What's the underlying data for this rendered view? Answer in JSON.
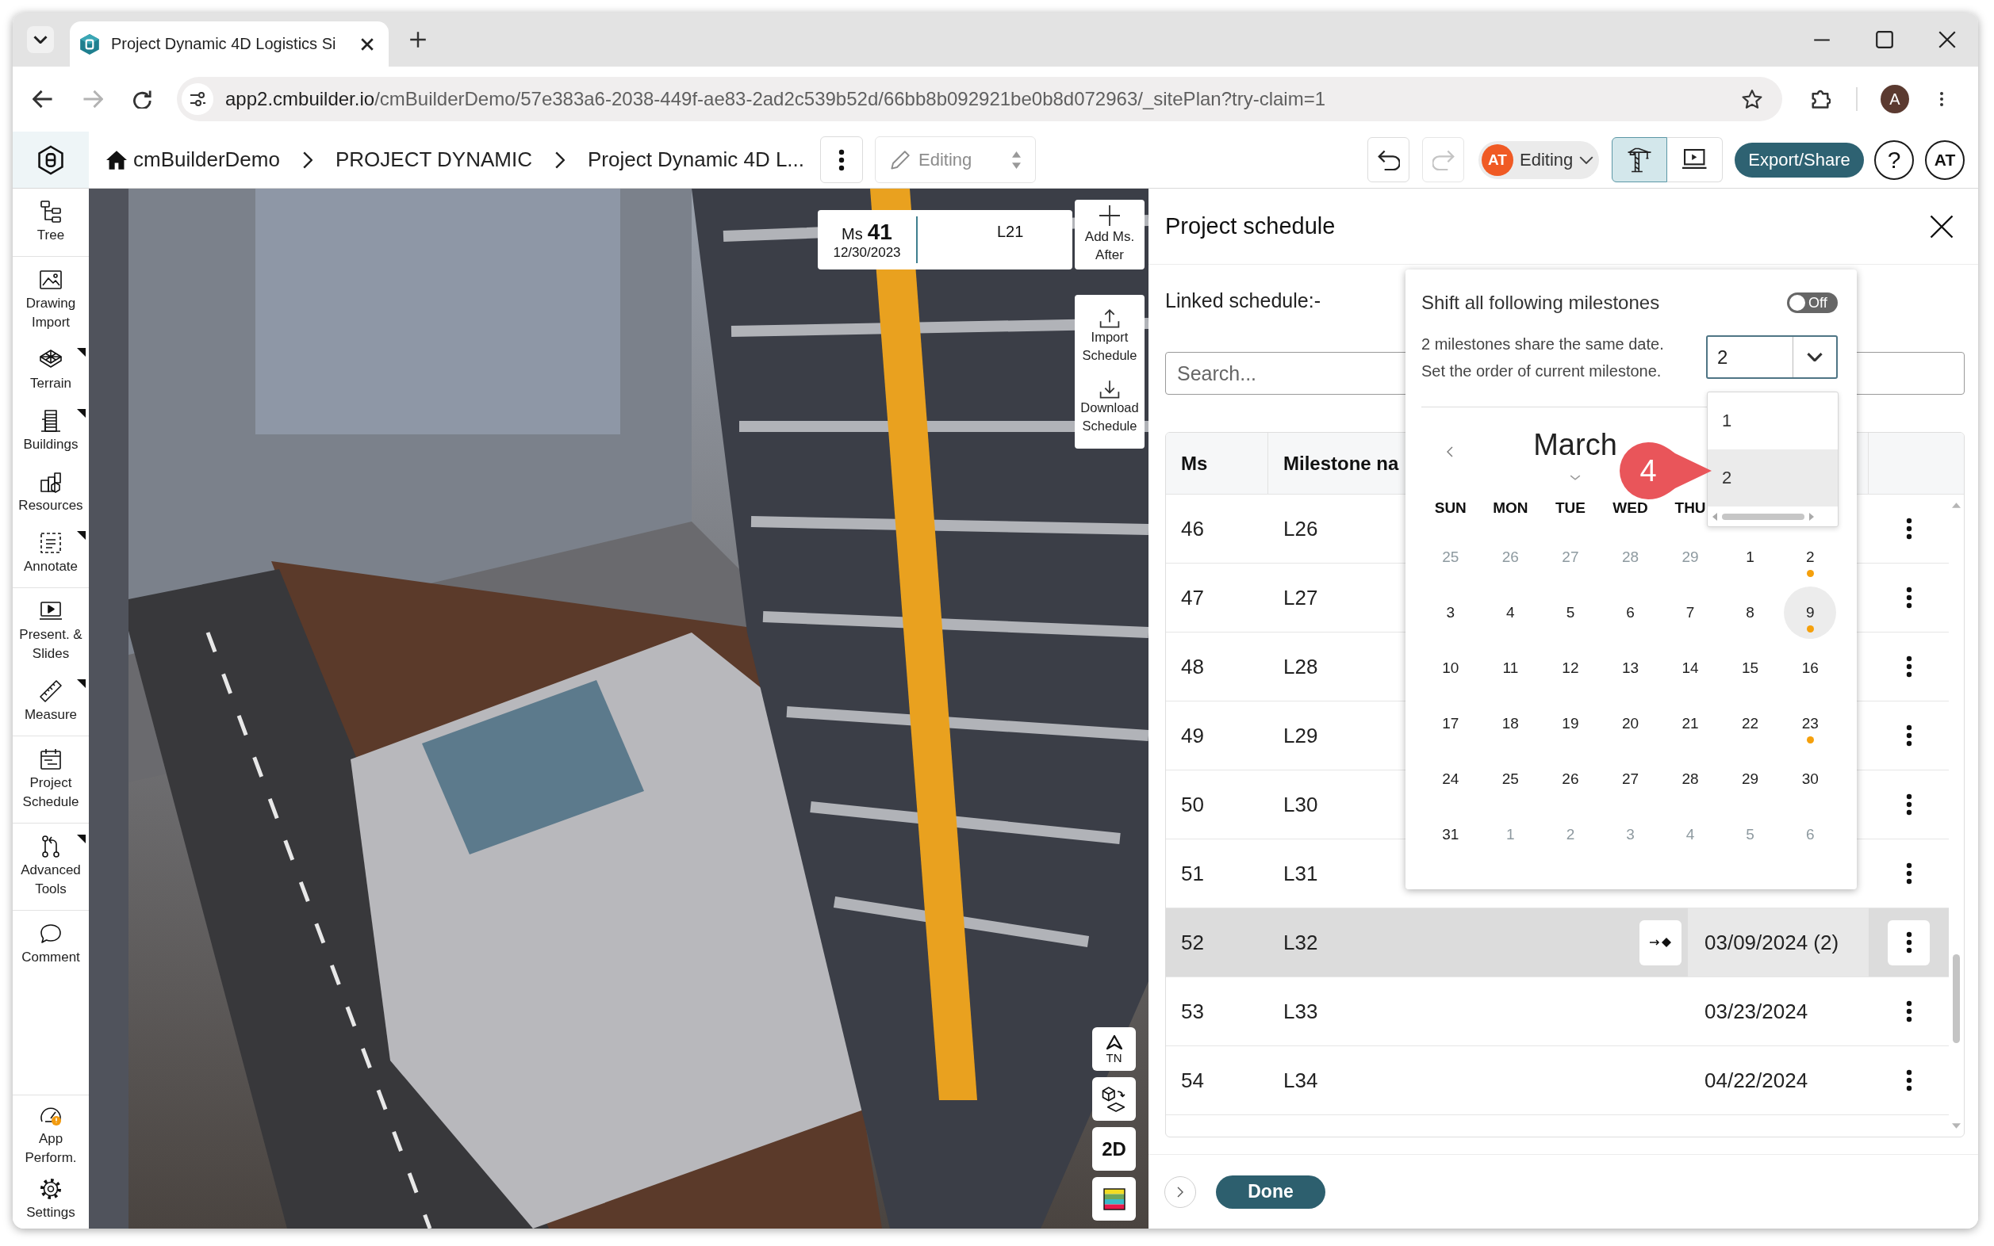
{
  "browser": {
    "tab_title": "Project Dynamic 4D Logistics Si",
    "forward_disabled": true,
    "url_host": "app2.cmbuilder.io",
    "url_path": "/cmBuilderDemo/57e383a6-2038-449f-ae83-2ad2c539b52d/66bb8b092921be0b8d072963/_sitePlan?try-claim=1",
    "profile_initial": "A"
  },
  "toolbar": {
    "breadcrumbs": [
      "cmBuilderDemo",
      "PROJECT DYNAMIC",
      "Project Dynamic 4D L..."
    ],
    "mode_field": {
      "value": "Editing",
      "disabled": true
    },
    "redo_disabled": true,
    "presence": {
      "initials": "AT",
      "label": "Editing"
    },
    "view_modes": [
      {
        "selected": true
      },
      {
        "selected": false
      }
    ],
    "export_label": "Export/Share",
    "help_label": "?",
    "user_initials": "AT"
  },
  "sidebar": {
    "groups": [
      {
        "items": [
          {
            "label": "Tree",
            "submenu": false
          }
        ]
      },
      {
        "items": [
          {
            "label": "Drawing Import",
            "submenu": false
          },
          {
            "label": "Terrain",
            "submenu": true
          },
          {
            "label": "Buildings",
            "submenu": true
          },
          {
            "label": "Resources",
            "submenu": false
          },
          {
            "label": "Annotate",
            "submenu": true
          }
        ]
      },
      {
        "items": [
          {
            "label": "Present. & Slides",
            "submenu": false
          },
          {
            "label": "Measure",
            "submenu": true
          }
        ]
      },
      {
        "items": [
          {
            "label": "Project Schedule",
            "submenu": false
          }
        ]
      },
      {
        "items": [
          {
            "label": "Advanced Tools",
            "submenu": true
          }
        ]
      },
      {
        "items": [
          {
            "label": "Comment",
            "submenu": false
          }
        ]
      }
    ],
    "footer_items": [
      {
        "label": "App Perform.",
        "warning": true
      },
      {
        "label": "Settings",
        "warning": false
      }
    ]
  },
  "viewport": {
    "milestone": {
      "label": "Ms",
      "number": "41",
      "date": "12/30/2023",
      "name": "L21"
    },
    "add_label": "Add Ms. After",
    "schedule_actions": [
      "Import Schedule",
      "Download Schedule"
    ],
    "map_controls": [
      {
        "kind": "compass",
        "label": "TN"
      },
      {
        "kind": "view-switch"
      },
      {
        "kind": "text",
        "label": "2D"
      },
      {
        "kind": "layers"
      }
    ]
  },
  "panel": {
    "title": "Project schedule",
    "linked_label": "Linked schedule:-",
    "search_placeholder": "Search...",
    "columns": [
      "Ms",
      "Milestone na"
    ],
    "rows": [
      {
        "ms": "46",
        "name": "L26",
        "selected": false
      },
      {
        "ms": "47",
        "name": "L27",
        "selected": false
      },
      {
        "ms": "48",
        "name": "L28",
        "selected": false
      },
      {
        "ms": "49",
        "name": "L29",
        "selected": false
      },
      {
        "ms": "50",
        "name": "L30",
        "selected": false
      },
      {
        "ms": "51",
        "name": "L31",
        "selected": false
      },
      {
        "ms": "52",
        "name": "L32",
        "date": "03/09/2024 (2)",
        "selected": true
      },
      {
        "ms": "53",
        "name": "L33",
        "date": "03/23/2024",
        "selected": false
      },
      {
        "ms": "54",
        "name": "L34",
        "date": "04/22/2024",
        "selected": false
      }
    ],
    "done_label": "Done"
  },
  "milestone_popover": {
    "shift_label": "Shift all following milestones",
    "shift_toggle": {
      "on": false,
      "label": "Off"
    },
    "info_lines": [
      "2 milestones share the same date.",
      "Set the order of current milestone."
    ],
    "order_select": {
      "value": "2",
      "expanded": true,
      "options": [
        {
          "label": "1",
          "selected": false
        },
        {
          "label": "2",
          "selected": true
        }
      ]
    },
    "calendar": {
      "month": "March",
      "weekdays": [
        "SUN",
        "MON",
        "TUE",
        "WED",
        "THU"
      ],
      "weeks": [
        [
          {
            "day": "25",
            "muted": true,
            "selected": false,
            "marked": false
          },
          {
            "day": "26",
            "muted": true,
            "selected": false,
            "marked": false
          },
          {
            "day": "27",
            "muted": true,
            "selected": false,
            "marked": false
          },
          {
            "day": "28",
            "muted": true,
            "selected": false,
            "marked": false
          },
          {
            "day": "29",
            "muted": true,
            "selected": false,
            "marked": false
          },
          {
            "day": "1",
            "muted": false,
            "selected": false,
            "marked": false
          },
          {
            "day": "2",
            "muted": false,
            "selected": false,
            "marked": true
          }
        ],
        [
          {
            "day": "3",
            "muted": false,
            "selected": false,
            "marked": false
          },
          {
            "day": "4",
            "muted": false,
            "selected": false,
            "marked": false
          },
          {
            "day": "5",
            "muted": false,
            "selected": false,
            "marked": false
          },
          {
            "day": "6",
            "muted": false,
            "selected": false,
            "marked": false
          },
          {
            "day": "7",
            "muted": false,
            "selected": false,
            "marked": false
          },
          {
            "day": "8",
            "muted": false,
            "selected": false,
            "marked": false
          },
          {
            "day": "9",
            "muted": false,
            "selected": true,
            "marked": true
          }
        ],
        [
          {
            "day": "10",
            "muted": false,
            "selected": false,
            "marked": false
          },
          {
            "day": "11",
            "muted": false,
            "selected": false,
            "marked": false
          },
          {
            "day": "12",
            "muted": false,
            "selected": false,
            "marked": false
          },
          {
            "day": "13",
            "muted": false,
            "selected": false,
            "marked": false
          },
          {
            "day": "14",
            "muted": false,
            "selected": false,
            "marked": false
          },
          {
            "day": "15",
            "muted": false,
            "selected": false,
            "marked": false
          },
          {
            "day": "16",
            "muted": false,
            "selected": false,
            "marked": false
          }
        ],
        [
          {
            "day": "17",
            "muted": false,
            "selected": false,
            "marked": false
          },
          {
            "day": "18",
            "muted": false,
            "selected": false,
            "marked": false
          },
          {
            "day": "19",
            "muted": false,
            "selected": false,
            "marked": false
          },
          {
            "day": "20",
            "muted": false,
            "selected": false,
            "marked": false
          },
          {
            "day": "21",
            "muted": false,
            "selected": false,
            "marked": false
          },
          {
            "day": "22",
            "muted": false,
            "selected": false,
            "marked": false
          },
          {
            "day": "23",
            "muted": false,
            "selected": false,
            "marked": true
          }
        ],
        [
          {
            "day": "24",
            "muted": false,
            "selected": false,
            "marked": false
          },
          {
            "day": "25",
            "muted": false,
            "selected": false,
            "marked": false
          },
          {
            "day": "26",
            "muted": false,
            "selected": false,
            "marked": false
          },
          {
            "day": "27",
            "muted": false,
            "selected": false,
            "marked": false
          },
          {
            "day": "28",
            "muted": false,
            "selected": false,
            "marked": false
          },
          {
            "day": "29",
            "muted": false,
            "selected": false,
            "marked": false
          },
          {
            "day": "30",
            "muted": false,
            "selected": false,
            "marked": false
          }
        ],
        [
          {
            "day": "31",
            "muted": false,
            "selected": false,
            "marked": false
          },
          {
            "day": "1",
            "muted": true,
            "selected": false,
            "marked": false
          },
          {
            "day": "2",
            "muted": true,
            "selected": false,
            "marked": false
          },
          {
            "day": "3",
            "muted": true,
            "selected": false,
            "marked": false
          },
          {
            "day": "4",
            "muted": true,
            "selected": false,
            "marked": false
          },
          {
            "day": "5",
            "muted": true,
            "selected": false,
            "marked": false
          },
          {
            "day": "6",
            "muted": true,
            "selected": false,
            "marked": false
          }
        ]
      ]
    }
  },
  "step_marker": {
    "label": "4"
  }
}
